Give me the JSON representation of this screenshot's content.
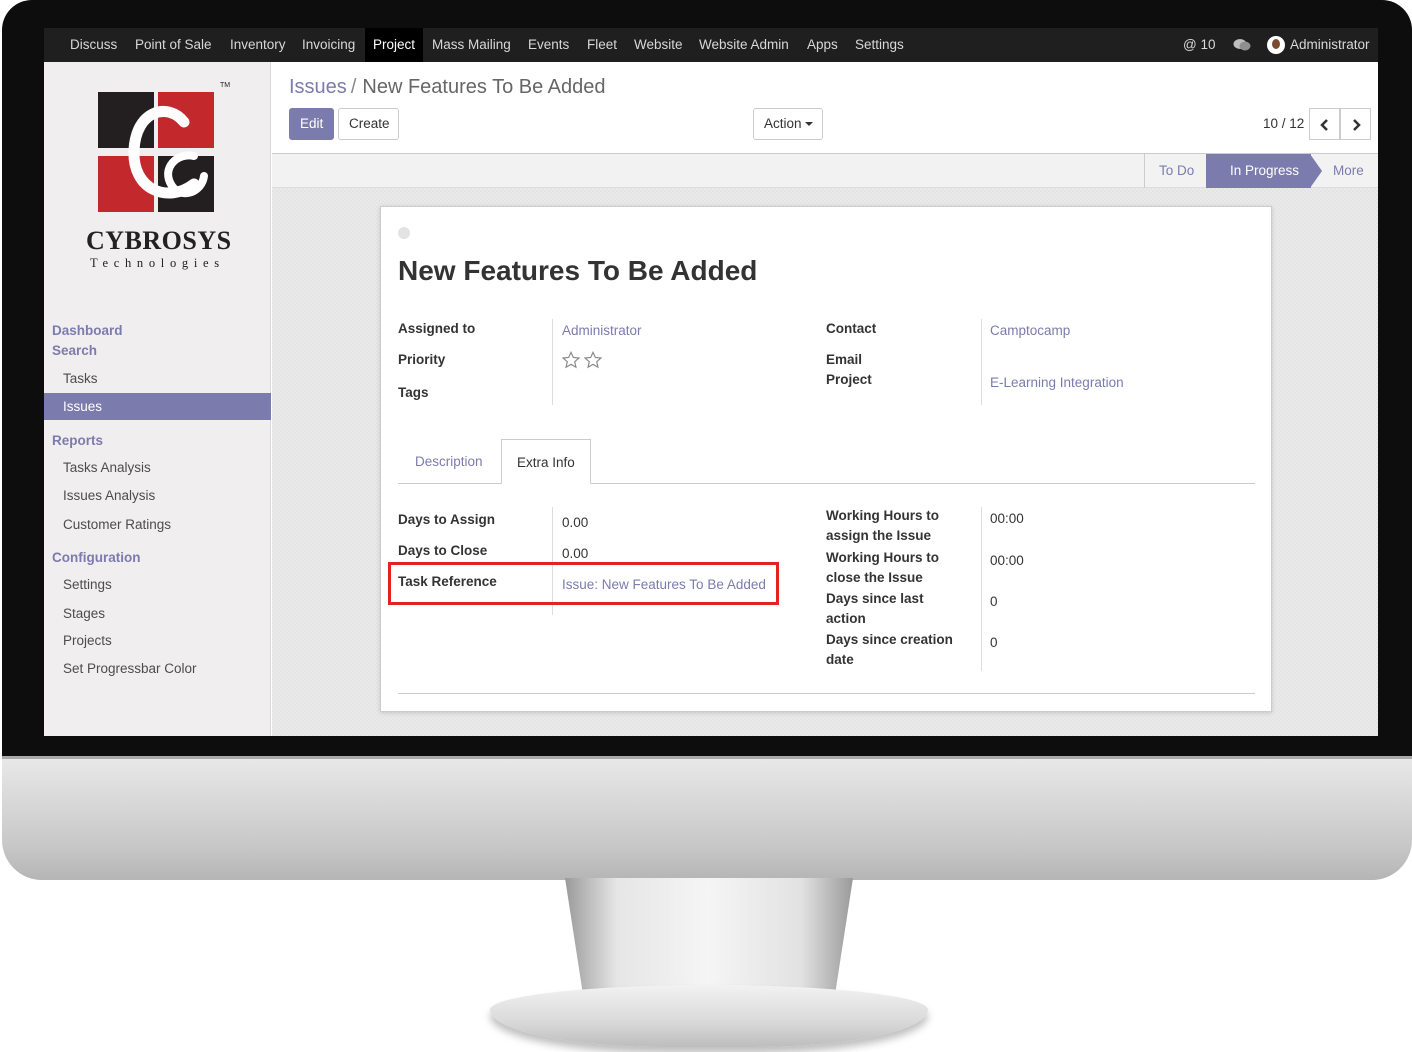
{
  "topbar": {
    "menu": [
      "Discuss",
      "Point of Sale",
      "Inventory",
      "Invoicing",
      "Project",
      "Mass Mailing",
      "Events",
      "Fleet",
      "Website",
      "Website Admin",
      "Apps",
      "Settings"
    ],
    "active_menu": "Project",
    "notifications": "@ 10",
    "user": "Administrator"
  },
  "logo": {
    "name": "CYBROSYS",
    "subtitle": "Technologies",
    "trademark": "TM"
  },
  "sidebar": {
    "dashboard": "Dashboard",
    "search": "Search",
    "search_items": [
      "Tasks",
      "Issues"
    ],
    "active_item": "Issues",
    "reports": "Reports",
    "reports_items": [
      "Tasks Analysis",
      "Issues Analysis",
      "Customer Ratings"
    ],
    "configuration": "Configuration",
    "configuration_items": [
      "Settings",
      "Stages",
      "Projects",
      "Set Progressbar Color"
    ]
  },
  "control_panel": {
    "breadcrumb_parent": "Issues",
    "breadcrumb_separator": "/",
    "breadcrumb_current": "New Features To Be Added",
    "edit_label": "Edit",
    "create_label": "Create",
    "action_label": "Action",
    "pager": "10 / 12"
  },
  "statusbar": {
    "stages": [
      "To Do",
      "In Progress",
      "More"
    ],
    "current": "In Progress"
  },
  "form": {
    "title": "New Features To Be Added",
    "assigned_to_label": "Assigned to",
    "assigned_to": "Administrator",
    "priority_label": "Priority",
    "priority_stars": 0,
    "tags_label": "Tags",
    "contact_label": "Contact",
    "contact": "Camptocamp",
    "email_label": "Email",
    "project_label": "Project",
    "project": "E-Learning Integration",
    "tabs": [
      "Description",
      "Extra Info"
    ],
    "active_tab": "Extra Info",
    "days_to_assign_label": "Days to Assign",
    "days_to_assign": "0.00",
    "days_to_close_label": "Days to Close",
    "days_to_close": "0.00",
    "task_reference_label": "Task Reference",
    "task_reference": "Issue: New Features To Be Added",
    "wh_assign_label_1": "Working Hours to",
    "wh_assign_label_2": "assign the Issue",
    "wh_assign": "00:00",
    "wh_close_label_1": "Working Hours to",
    "wh_close_label_2": "close the Issue",
    "wh_close": "00:00",
    "days_last_action_label_1": "Days since last",
    "days_last_action_label_2": "action",
    "days_last_action": "0",
    "days_creation_label_1": "Days since creation",
    "days_creation_label_2": "date",
    "days_creation": "0"
  },
  "colors": {
    "accent": "#7c7bad",
    "topbar": "#1f1f1f",
    "highlight": "#e32222",
    "logo_red": "#c3282d",
    "logo_dark": "#231f20"
  }
}
